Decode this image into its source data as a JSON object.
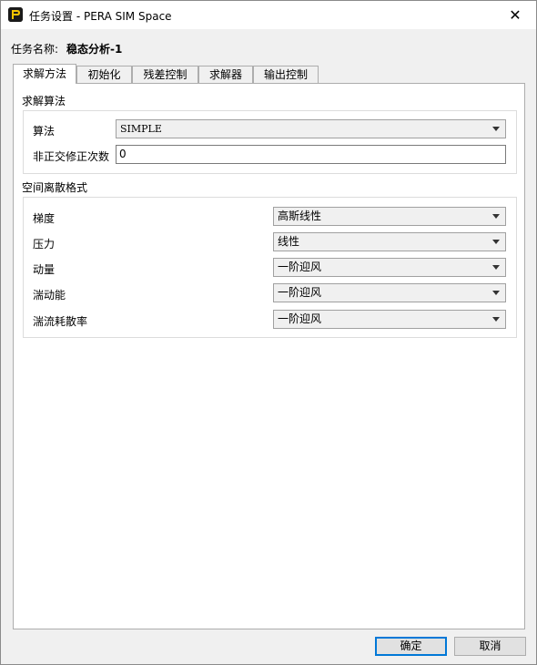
{
  "window": {
    "title": "任务设置 - PERA SIM Space",
    "close_glyph": "✕"
  },
  "task": {
    "name_label": "任务名称:",
    "name_value": "稳态分析-1"
  },
  "tabs": [
    {
      "label": "求解方法"
    },
    {
      "label": "初始化"
    },
    {
      "label": "残差控制"
    },
    {
      "label": "求解器"
    },
    {
      "label": "输出控制"
    }
  ],
  "solver_algorithm": {
    "section_title": "求解算法",
    "algorithm_label": "算法",
    "algorithm_value": "SIMPLE",
    "nonorth_label": "非正交修正次数",
    "nonorth_value": "0"
  },
  "discretization": {
    "section_title": "空间离散格式",
    "rows": [
      {
        "label": "梯度",
        "value": "高斯线性"
      },
      {
        "label": "压力",
        "value": "线性"
      },
      {
        "label": "动量",
        "value": "一阶迎风"
      },
      {
        "label": "湍动能",
        "value": "一阶迎风"
      },
      {
        "label": "湍流耗散率",
        "value": "一阶迎风"
      }
    ]
  },
  "buttons": {
    "ok": "确定",
    "cancel": "取消"
  }
}
